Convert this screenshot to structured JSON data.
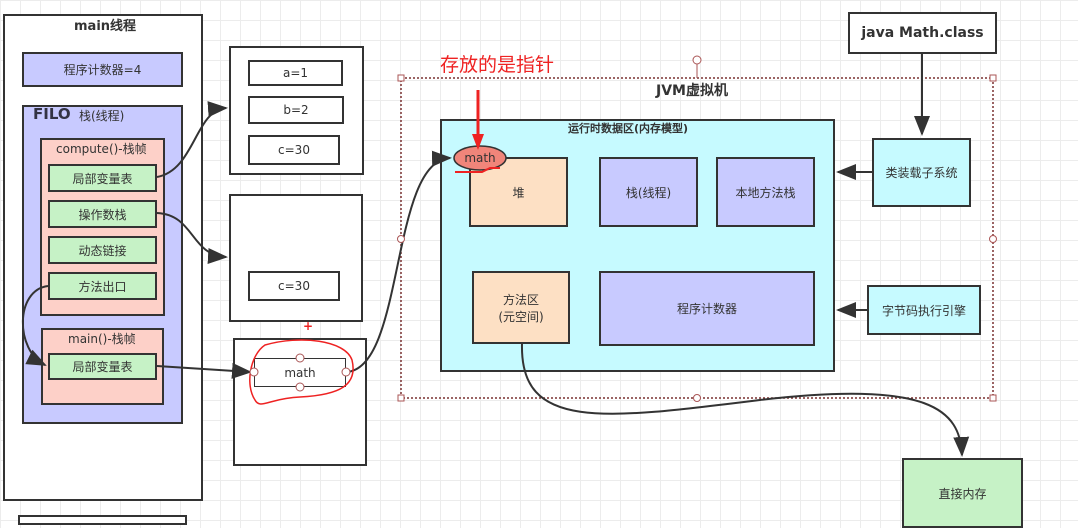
{
  "thread": {
    "title": "main线程",
    "pc": "程序计数器=4",
    "filo": "FILO",
    "stack_title": "栈(线程)",
    "compute_frame": {
      "title": "compute()-栈帧",
      "items": [
        "局部变量表",
        "操作数栈",
        "动态链接",
        "方法出口"
      ]
    },
    "main_frame": {
      "title": "main()-栈帧",
      "items": [
        "局部变量表"
      ]
    }
  },
  "locals_box": [
    "a=1",
    "b=2",
    "c=30"
  ],
  "operand_box": [
    "c=30"
  ],
  "main_locals_box": [
    "math"
  ],
  "annotation": {
    "text": "存放的是指针",
    "color": "#ee2222"
  },
  "jvm": {
    "title": "JVM虚拟机",
    "runtime": {
      "title": "运行时数据区(内存模型)",
      "heap": "堆",
      "heap_pointer": "math",
      "stack": "栈(线程)",
      "native_stack": "本地方法栈",
      "method_area": "方法区\n(元空间)",
      "pc": "程序计数器"
    },
    "classloader": "类装载子系统",
    "engine": "字节码执行引擎"
  },
  "class_file": "java Math.class",
  "direct_memory": "直接内存"
}
